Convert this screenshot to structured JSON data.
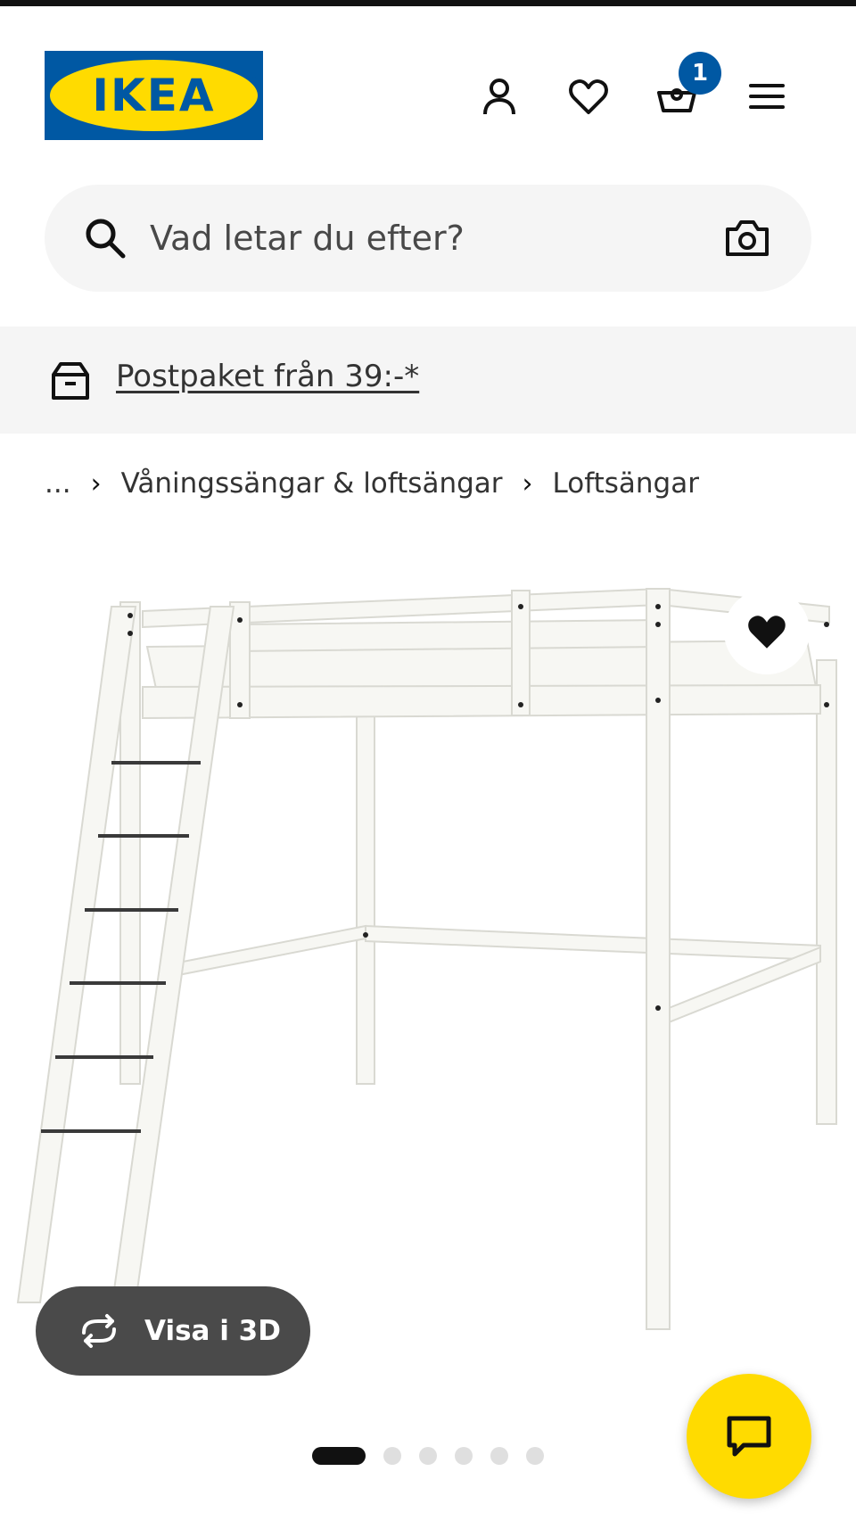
{
  "header": {
    "logo_text": "IKEA",
    "logo_reg": "®",
    "cart_count": "1",
    "icons": [
      "user-icon",
      "heart-icon",
      "basket-icon",
      "menu-icon"
    ]
  },
  "search": {
    "placeholder": "Vad letar du efter?"
  },
  "promo": {
    "label": "Postpaket från 39:-*"
  },
  "breadcrumb": {
    "ellipsis": "...",
    "items": [
      "Våningssängar & loftsängar",
      "Loftsängar"
    ]
  },
  "product_image": {
    "view_3d_label": "Visa i 3D",
    "slides_total": 6,
    "slide_active": 1
  },
  "colors": {
    "brand_blue": "#0058a3",
    "brand_yellow": "#ffdb00",
    "search_bg": "#f5f5f5"
  }
}
